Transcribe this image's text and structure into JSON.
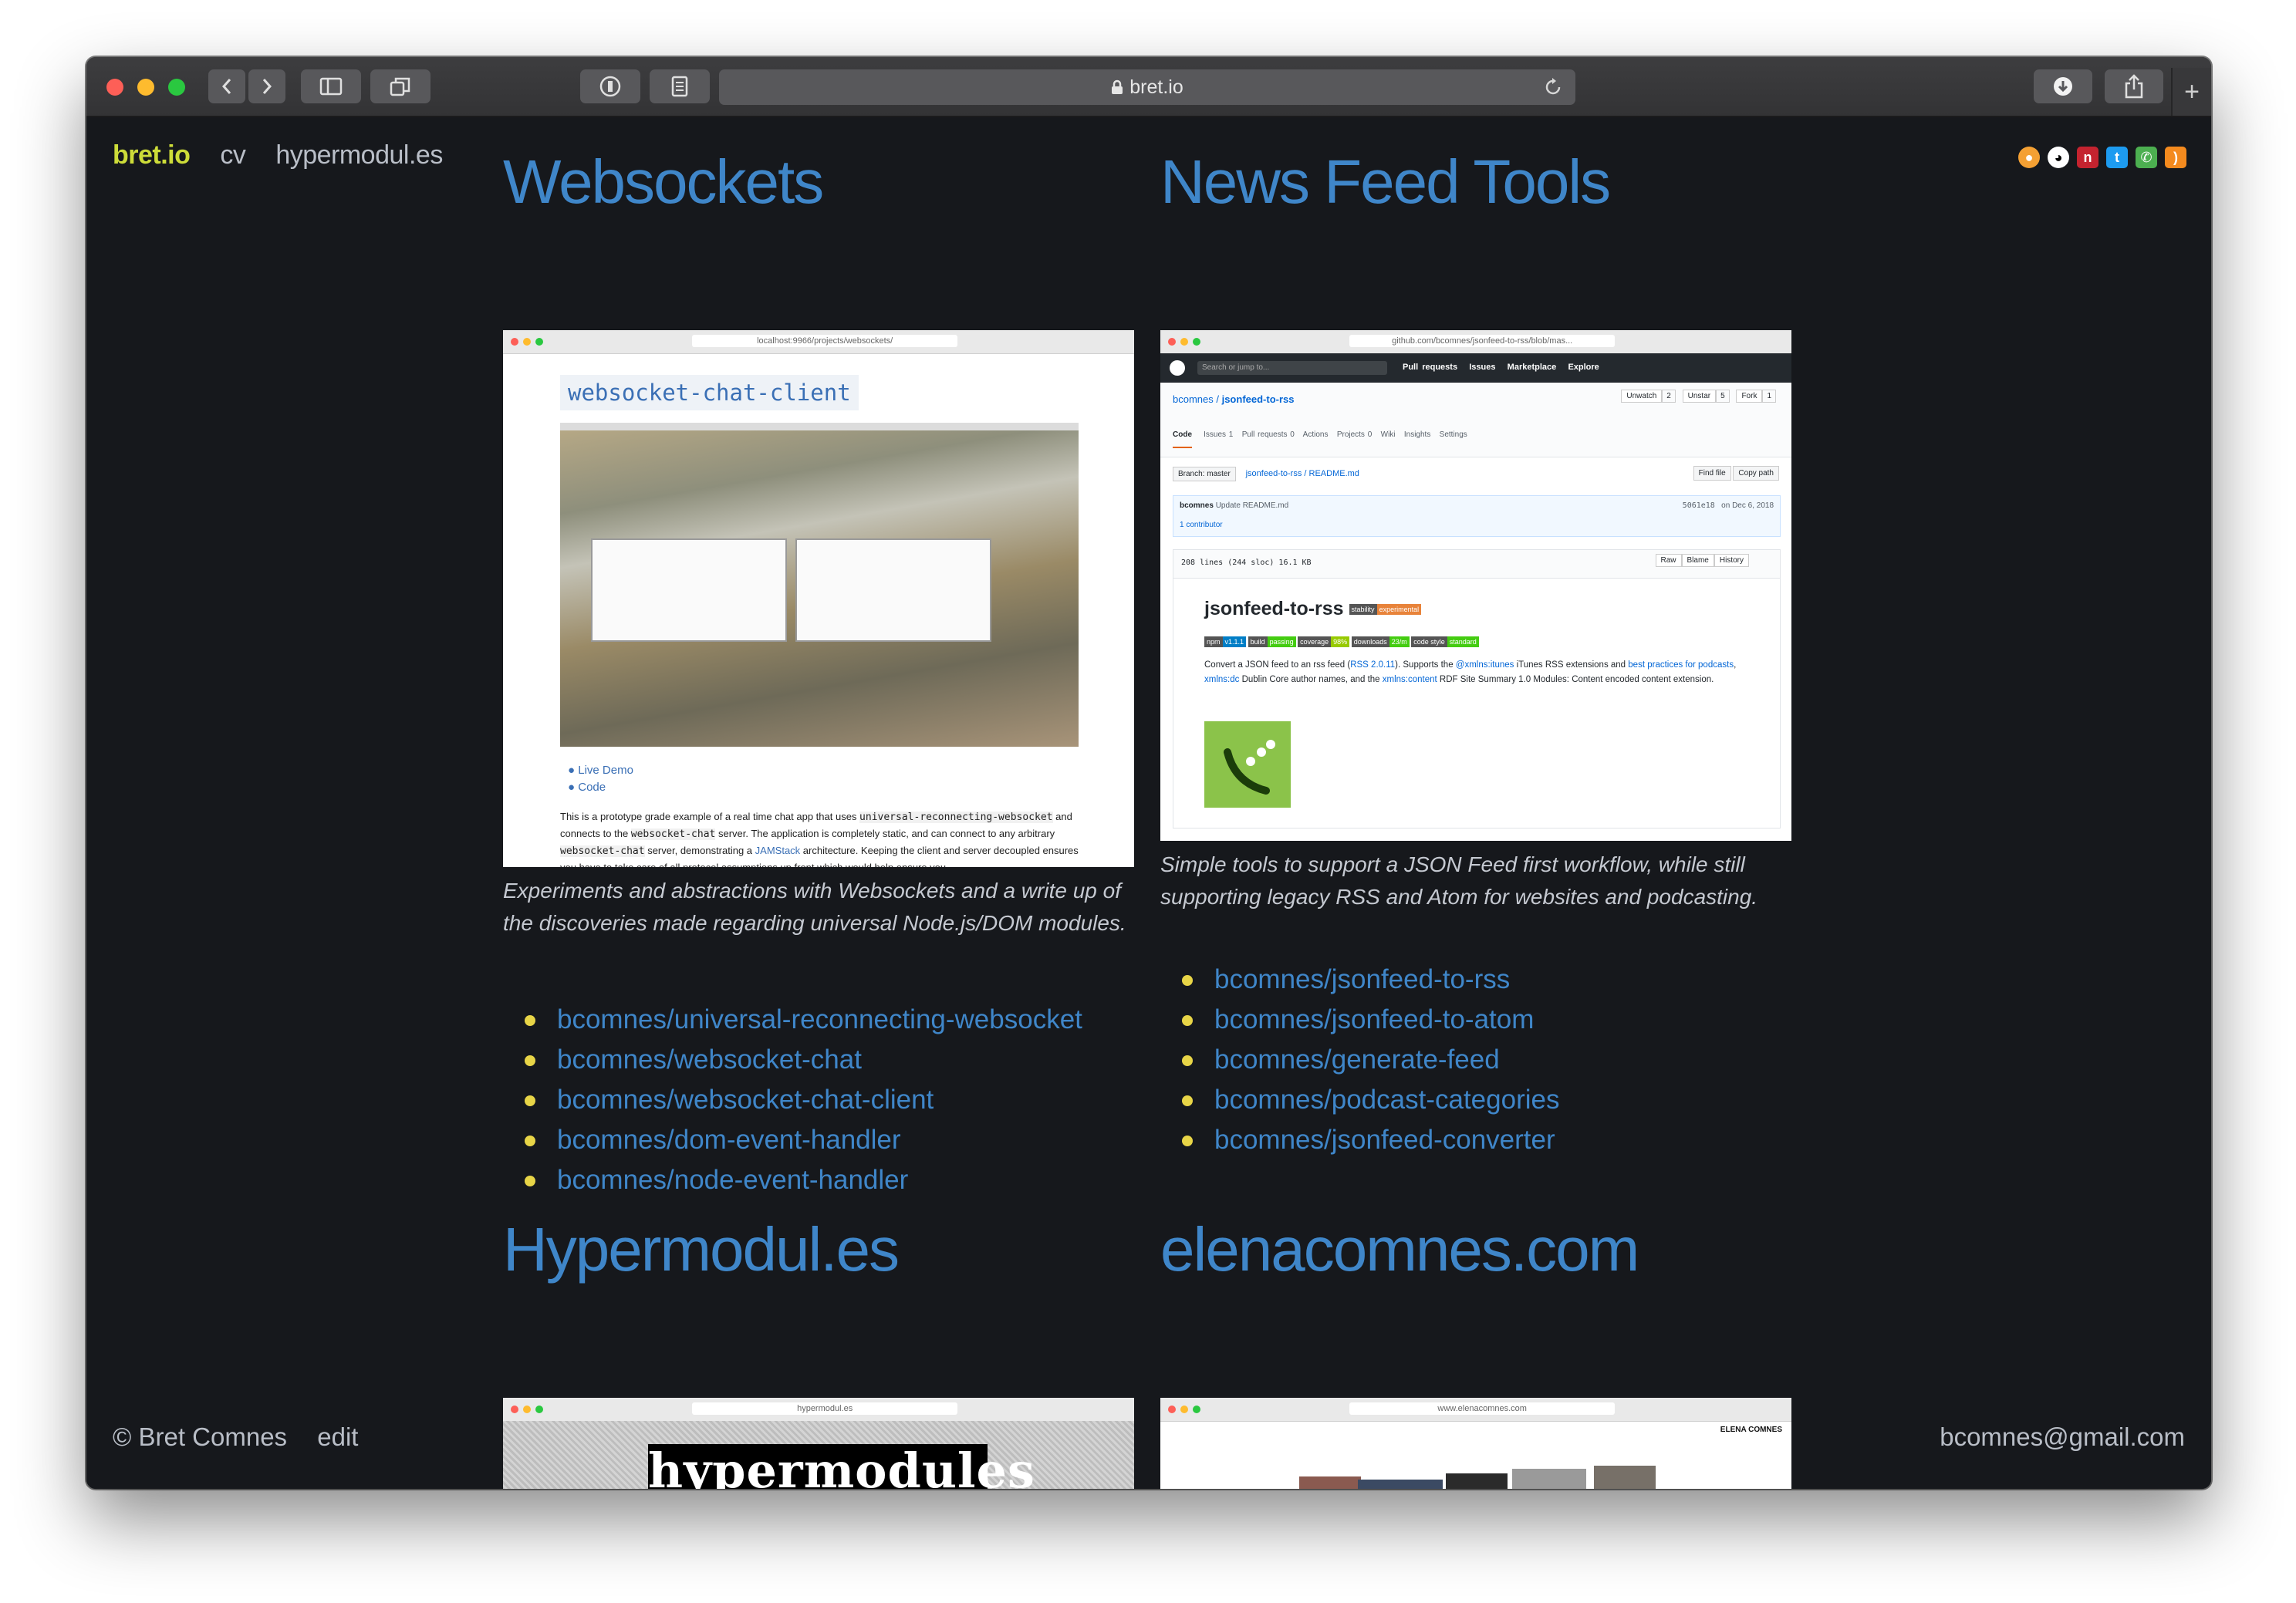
{
  "browser": {
    "address": "bret.io",
    "new_tab_icon": "+"
  },
  "nav": {
    "brand": "bret.io",
    "links": [
      "cv",
      "hypermodul.es"
    ]
  },
  "social_icons": [
    "keybase-icon",
    "github-icon",
    "npm-icon",
    "twitter-icon",
    "phone-icon",
    "rss-icon"
  ],
  "sections": {
    "websockets": {
      "title": "Websockets",
      "screenshot": {
        "url": "localhost:9966/projects/websockets/",
        "heading": "websocket-chat-client",
        "bullets": [
          "Live Demo",
          "Code"
        ],
        "body_prefix": "This is a prototype grade example of a real time chat app that uses ",
        "body_code": "universal-reconnecting-websocket",
        "body_mid": " and connects to the ",
        "body_code2": "websocket-chat",
        "body_suffix": " server. The application is completely static, and can connect to any arbitrary ",
        "body_code3": "websocket-chat",
        "body_suffix2": " server, demonstrating a ",
        "body_link": "JAMStack",
        "body_end": " architecture. Keeping the client and server decoupled ensures you have to take care of all protocol assumptions up front which would help ensure you"
      },
      "description": "Experiments and abstractions with Websockets and a write up of the discoveries made regarding universal Node.js/DOM modules.",
      "repos": [
        "bcomnes/universal-reconnecting-websocket",
        "bcomnes/websocket-chat",
        "bcomnes/websocket-chat-client",
        "bcomnes/dom-event-handler",
        "bcomnes/node-event-handler"
      ]
    },
    "newsfeed": {
      "title": "News Feed Tools",
      "screenshot": {
        "url": "github.com/bcomnes/jsonfeed-to-rss/blob/mas...",
        "search_placeholder": "Search or jump to...",
        "gh_nav": [
          "Pull requests",
          "Issues",
          "Marketplace",
          "Explore"
        ],
        "repo_owner": "bcomnes",
        "repo_name": "jsonfeed-to-rss",
        "watch": "Unwatch",
        "watch_count": "2",
        "star": "Unstar",
        "star_count": "5",
        "fork": "Fork",
        "fork_count": "1",
        "tabs": [
          "Code",
          "Issues 1",
          "Pull requests 0",
          "Actions",
          "Projects 0",
          "Wiki",
          "Insights",
          "Settings"
        ],
        "branch": "Branch: master",
        "path": "jsonfeed-to-rss / README.md",
        "find_file": "Find file",
        "copy_path": "Copy path",
        "commit_author": "bcomnes",
        "commit_msg": "Update README.md",
        "commit_hash": "5061e18",
        "commit_date": "on Dec 6, 2018",
        "contributors": "1 contributor",
        "file_info": "208 lines (244 sloc)   16.1 KB",
        "file_btns": [
          "Raw",
          "Blame",
          "History"
        ],
        "readme_title": "jsonfeed-to-rss",
        "stability": "stability",
        "experimental": "experimental",
        "badges": [
          "npm",
          "v1.1.1",
          "build",
          "passing",
          "coverage",
          "98%",
          "downloads",
          "23/m",
          "code style",
          "standard"
        ],
        "readme_p1": "Convert a JSON feed to an rss feed (",
        "readme_rss": "RSS 2.0.11",
        "readme_p2": "). Supports the ",
        "readme_itunes": "@xmlns:itunes",
        "readme_p3": " iTunes RSS extensions and ",
        "readme_best": "best practices for podcasts",
        "readme_p4": ", ",
        "readme_dc": "xmlns:dc",
        "readme_p5": " Dublin Core author names, and the ",
        "readme_content": "xmlns:content",
        "readme_p6": " RDF Site Summary 1.0 Modules: Content encoded content extension."
      },
      "description": "Simple tools to support a JSON Feed first workflow, while still supporting legacy RSS and Atom for websites and podcasting.",
      "repos": [
        "bcomnes/jsonfeed-to-rss",
        "bcomnes/jsonfeed-to-atom",
        "bcomnes/generate-feed",
        "bcomnes/podcast-categories",
        "bcomnes/jsonfeed-converter"
      ]
    },
    "hypermodules": {
      "title": "Hypermodul.es",
      "screenshot": {
        "url": "hypermodul.es",
        "logo": "hypermodules"
      }
    },
    "elena": {
      "title": "elenacomnes.com",
      "screenshot": {
        "url": "www.elenacomnes.com",
        "brand": "ELENA COMNES"
      }
    }
  },
  "footer": {
    "copyright": "© Bret Comnes",
    "edit": "edit",
    "email": "bcomnes@gmail.com"
  },
  "colors": {
    "background": "#16181c",
    "accent_link": "#3f86c9",
    "brand": "#cddc39",
    "bullet": "#e8d547",
    "text": "#c5c9d1"
  }
}
